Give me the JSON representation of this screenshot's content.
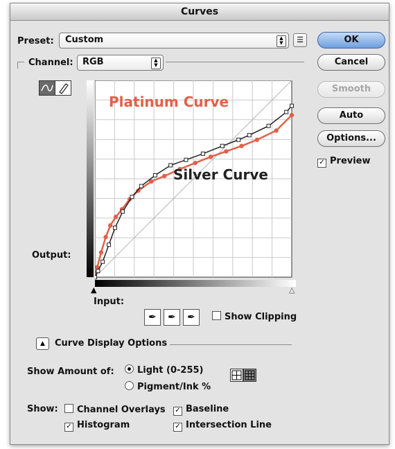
{
  "window": {
    "title": "Curves"
  },
  "preset": {
    "label": "Preset:",
    "value": "Custom"
  },
  "channel": {
    "label": "Channel:",
    "value": "RGB"
  },
  "buttons": {
    "ok": "OK",
    "cancel": "Cancel",
    "smooth": "Smooth",
    "auto": "Auto",
    "options": "Options..."
  },
  "preview": {
    "label": "Preview",
    "checked": true
  },
  "graph": {
    "output_label": "Output:",
    "input_label": "Input:",
    "platinum_label": "Platinum Curve",
    "silver_label": "Silver Curve",
    "platinum_color": "#e0614a",
    "silver_color": "#222222",
    "platinum_points": [
      [
        0,
        0
      ],
      [
        3,
        13
      ],
      [
        8,
        32
      ],
      [
        14,
        52
      ],
      [
        20,
        67
      ],
      [
        27,
        78
      ],
      [
        35,
        88
      ],
      [
        45,
        101
      ],
      [
        56,
        112
      ],
      [
        73,
        124
      ],
      [
        90,
        131
      ],
      [
        110,
        140
      ],
      [
        130,
        148
      ],
      [
        150,
        156
      ],
      [
        170,
        163
      ],
      [
        190,
        170
      ],
      [
        210,
        178
      ],
      [
        235,
        190
      ],
      [
        255,
        210
      ]
    ],
    "silver_points": [
      [
        0,
        0
      ],
      [
        4,
        8
      ],
      [
        10,
        20
      ],
      [
        18,
        42
      ],
      [
        26,
        64
      ],
      [
        36,
        85
      ],
      [
        48,
        104
      ],
      [
        60,
        118
      ],
      [
        78,
        132
      ],
      [
        98,
        145
      ],
      [
        118,
        152
      ],
      [
        140,
        160
      ],
      [
        165,
        170
      ],
      [
        186,
        178
      ],
      [
        200,
        184
      ],
      [
        225,
        196
      ],
      [
        248,
        214
      ],
      [
        255,
        222
      ]
    ]
  },
  "eyedroppers": {
    "show_clipping": "Show Clipping"
  },
  "display_options": {
    "title": "Curve Display Options",
    "show_amount_label": "Show Amount of:",
    "light": "Light  (0-255)",
    "pigment": "Pigment/Ink %",
    "show_label": "Show:",
    "channel_overlays": "Channel Overlays",
    "baseline": "Baseline",
    "histogram": "Histogram",
    "intersection_line": "Intersection Line"
  }
}
